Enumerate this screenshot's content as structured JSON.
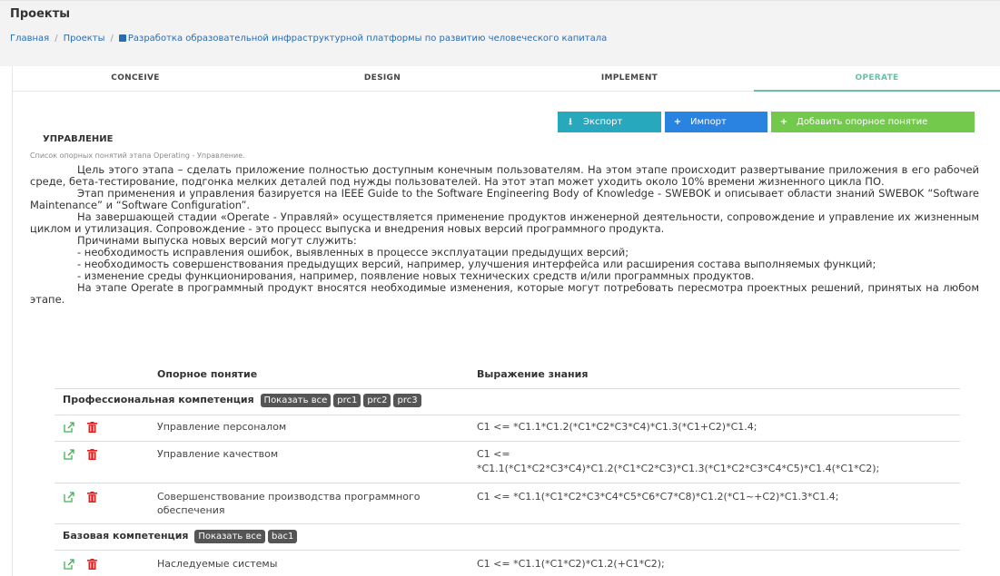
{
  "header": {
    "title": "Проекты",
    "breadcrumb": [
      "Главная",
      "Проекты",
      "Разработка образовательной инфраструктурной платформы по развитию человеческого капитала"
    ]
  },
  "tabs": [
    {
      "label": "CONCEIVE",
      "active": false
    },
    {
      "label": "DESIGN",
      "active": false
    },
    {
      "label": "IMPLEMENT",
      "active": false
    },
    {
      "label": "OPERATE",
      "active": true
    }
  ],
  "toolbar": {
    "export_label": "Экспорт",
    "import_label": "Импорт",
    "add_label": "Добавить опорное понятие"
  },
  "section": {
    "title": "УПРАВЛЕНИЕ",
    "subtitle": "Список опорных понятий этапа Operating - Управление."
  },
  "description": [
    "Цель этого этапа – сделать приложение полностью доступным конечным пользователям. На этом этапе происходит развертывание приложения в его рабочей среде, бета-тестирование, подгонка мелких деталей под нужды пользователей. На этот этап может уходить около 10% времени жизненного цикла ПО.",
    "Этап применения и управления базируется на IEEE Guide to the Software Engineering Body of Knowledge - SWEBOK и описывает области знаний SWEBOK “Software Maintenance” и “Software Configuration”.",
    "На завершающей стадии «Operate - Управляй» осуществляется применение продуктов инженерной деятельности, сопровождение и управление их жизненным циклом и утилизация. Сопровождение - это процесс выпуска и внедрения новых версий программного продукта.",
    "Причинами выпуска новых версий могут служить:",
    "- необходимость исправления ошибок, выявленных в процессе эксплуатации предыдущих версий;",
    "- необходимость совершенствования предыдущих версий, например, улучшения интерфейса или расширения состава выполняемых функций;",
    "- изменение среды функционирования, например, появление новых технических средств и/или программных продуктов.",
    "На этапе Operate в программный продукт вносятся необходимые изменения, которые могут потребовать пересмотра проектных решений, принятых на любом этапе."
  ],
  "table": {
    "col_concept": "Опорное понятие",
    "col_expression": "Выражение знания",
    "groups": [
      {
        "name": "Профессиональная компетенция",
        "tags": [
          "Показать все",
          "prc1",
          "prc2",
          "prc3"
        ],
        "rows": [
          {
            "name": "Управление персоналом",
            "expr": "C1 <= *C1.1*C1.2(*C1*C2*C3*C4)*C1.3(*C1+C2)*C1.4;"
          },
          {
            "name": "Управление качеством",
            "expr": "C1 <=",
            "expr2": "*C1.1(*C1*C2*C3*C4)*C1.2(*C1*C2*C3)*C1.3(*C1*C2*C3*C4*C5)*C1.4(*C1*C2);"
          },
          {
            "name": "Совершенствование производства программного",
            "name2": "обеспечения",
            "expr": "C1 <= *C1.1(*C1*C2*C3*C4*C5*C6*C7*C8)*C1.2(*C1~+C2)*C1.3*C1.4;"
          }
        ]
      },
      {
        "name": "Базовая компетенция",
        "tags": [
          "Показать все",
          "bac1"
        ],
        "rows": [
          {
            "name": "Наследуемые системы",
            "expr": "C1 <= *C1.1(*C1*C2)*C1.2(+C1*C2);"
          }
        ]
      }
    ]
  },
  "colors": {
    "accent": "#6cc0a8",
    "export": "#27a8bd",
    "import": "#2a83e0",
    "add": "#72c94c",
    "edit": "#3fb34f",
    "delete": "#e02020"
  }
}
